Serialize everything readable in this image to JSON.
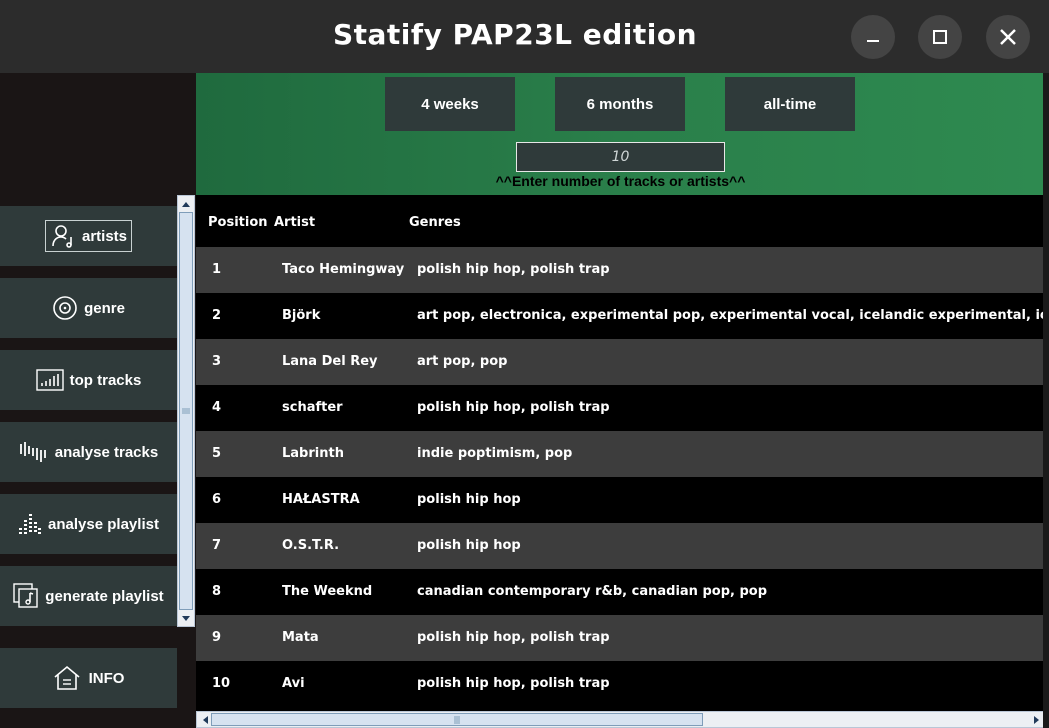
{
  "window": {
    "title": "Statify PAP23L edition"
  },
  "sidebar": {
    "items": [
      {
        "label": "artists",
        "icon": "artist-icon",
        "selected": true
      },
      {
        "label": "genre",
        "icon": "vinyl-icon",
        "selected": false
      },
      {
        "label": "top tracks",
        "icon": "bar-chart-icon",
        "selected": false
      },
      {
        "label": "analyse tracks",
        "icon": "waveform-icon",
        "selected": false
      },
      {
        "label": "analyse playlist",
        "icon": "equalizer-icon",
        "selected": false
      },
      {
        "label": "generate playlist",
        "icon": "playlist-icon",
        "selected": false
      }
    ],
    "info_label": "INFO"
  },
  "time_ranges": {
    "short": "4 weeks",
    "medium": "6 months",
    "long": "all-time"
  },
  "count_input": {
    "value": "10"
  },
  "hint": "^^Enter number of tracks or artists^^",
  "table": {
    "headers": {
      "position": "Position",
      "artist": "Artist",
      "genres": "Genres"
    },
    "rows": [
      {
        "position": "1",
        "artist": "Taco Hemingway",
        "genres": "polish hip hop, polish trap"
      },
      {
        "position": "2",
        "artist": "Björk",
        "genres": "art pop, electronica, experimental pop, experimental vocal, icelandic experimental, icela"
      },
      {
        "position": "3",
        "artist": "Lana Del Rey",
        "genres": "art pop, pop"
      },
      {
        "position": "4",
        "artist": "schafter",
        "genres": "polish hip hop, polish trap"
      },
      {
        "position": "5",
        "artist": "Labrinth",
        "genres": "indie poptimism, pop"
      },
      {
        "position": "6",
        "artist": "HAŁASTRA",
        "genres": "polish hip hop"
      },
      {
        "position": "7",
        "artist": "O.S.T.R.",
        "genres": "polish hip hop"
      },
      {
        "position": "8",
        "artist": "The Weeknd",
        "genres": "canadian contemporary r&b, canadian pop, pop"
      },
      {
        "position": "9",
        "artist": "Mata",
        "genres": "polish hip hop, polish trap"
      },
      {
        "position": "10",
        "artist": "Avi",
        "genres": "polish hip hop, polish trap"
      }
    ]
  },
  "colors": {
    "button_bg": "#2f3a3a",
    "accent_green": "#2a7f4a",
    "row_alt": "#3d3d3d"
  }
}
